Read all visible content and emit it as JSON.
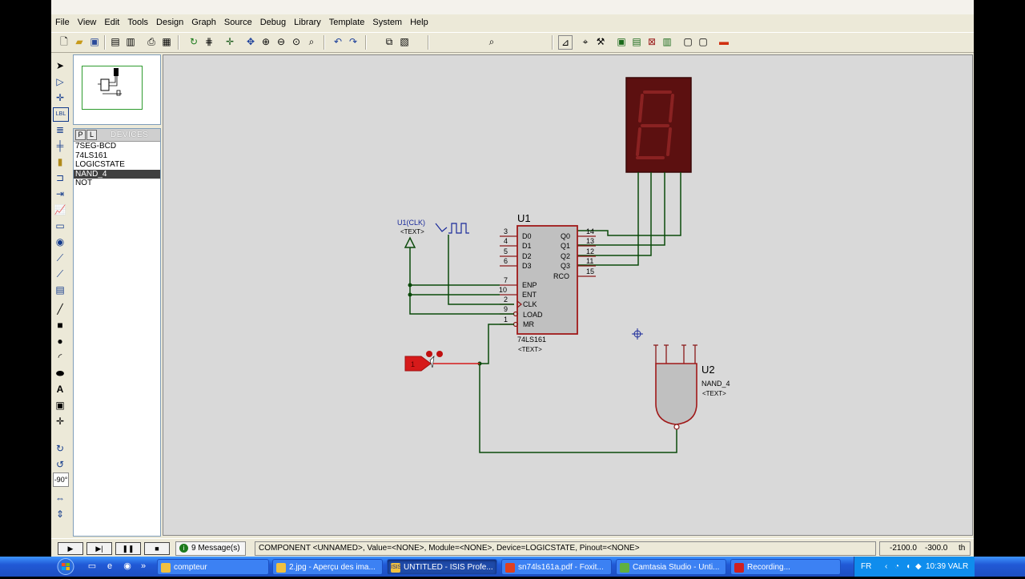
{
  "menu": [
    "File",
    "View",
    "Edit",
    "Tools",
    "Design",
    "Graph",
    "Source",
    "Debug",
    "Library",
    "Template",
    "System",
    "Help"
  ],
  "devices": {
    "p_label": "P",
    "l_label": "L",
    "title": "DEVICES",
    "items": [
      "7SEG-BCD",
      "74LS161",
      "LOGICSTATE",
      "NAND_4",
      "NOT"
    ],
    "selected_index": 3
  },
  "rotation": "-90°",
  "schematic": {
    "u1_ref": "U1",
    "u1_part": "74LS161",
    "u1_text": "<TEXT>",
    "u1_left_pins": [
      {
        "num": "3",
        "name": "D0"
      },
      {
        "num": "4",
        "name": "D1"
      },
      {
        "num": "5",
        "name": "D2"
      },
      {
        "num": "6",
        "name": "D3"
      },
      {
        "num": "7",
        "name": "ENP"
      },
      {
        "num": "10",
        "name": "ENT"
      },
      {
        "num": "2",
        "name": "CLK"
      },
      {
        "num": "9",
        "name": "LOAD"
      },
      {
        "num": "1",
        "name": "MR"
      }
    ],
    "u1_right_pins": [
      {
        "num": "14",
        "name": "Q0"
      },
      {
        "num": "13",
        "name": "Q1"
      },
      {
        "num": "12",
        "name": "Q2"
      },
      {
        "num": "11",
        "name": "Q3"
      },
      {
        "num": "15",
        "name": "RCO"
      }
    ],
    "clk_label": "U1(CLK)",
    "clk_text": "<TEXT>",
    "u2_ref": "U2",
    "u2_part": "NAND_4",
    "u2_text": "<TEXT>",
    "logicstate_value": "1",
    "seg_digit": "8",
    "colors": {
      "component_border": "#a01818",
      "wire": "#0b4a0b",
      "component_fill": "#c0c0c0",
      "seg_bg": "#5c1010",
      "seg_on": "#7a1a1a",
      "logicstate": "#d61a1a"
    }
  },
  "status": {
    "sim_buttons": [
      "play-icon",
      "step-icon",
      "pause-icon",
      "stop-icon"
    ],
    "messages_icon_label": "i",
    "messages": "9 Message(s)",
    "text": "COMPONENT <UNNAMED>, Value=<NONE>, Module=<NONE>, Device=LOGICSTATE, Pinout=<NONE>",
    "x": "-2100.0",
    "y": "-300.0",
    "units": "th"
  },
  "taskbar": {
    "tasks": [
      {
        "label": "compteur",
        "icon": "folder-icon",
        "active": false
      },
      {
        "label": "2.jpg - Aperçu des ima...",
        "icon": "image-icon",
        "active": false
      },
      {
        "label": "UNTITLED - ISIS Profe...",
        "icon": "isis-icon",
        "icon_text": "ISIS",
        "active": true
      },
      {
        "label": "sn74ls161a.pdf - Foxit...",
        "icon": "pdf-icon",
        "active": false
      },
      {
        "label": "Camtasia Studio - Unti...",
        "icon": "camtasia-icon",
        "active": false
      },
      {
        "label": "Recording...",
        "icon": "recording-icon",
        "active": false
      }
    ],
    "lang": "FR",
    "clock": "10:39 VALR"
  }
}
